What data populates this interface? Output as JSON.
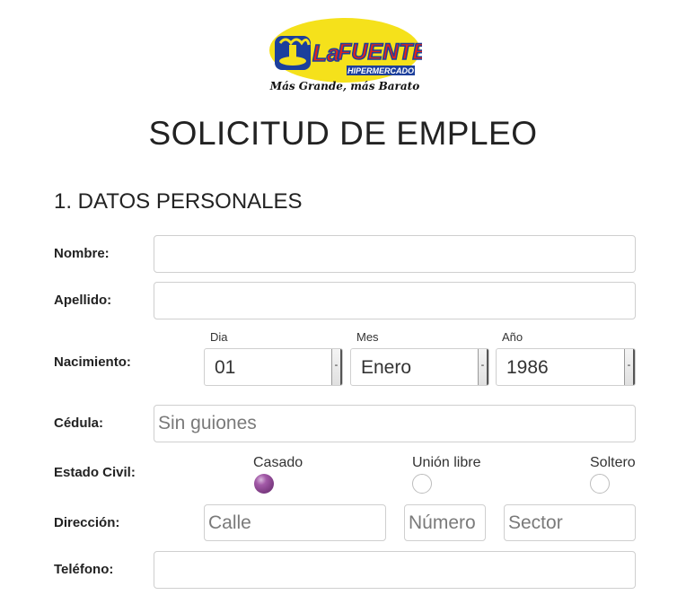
{
  "logo": {
    "brand_prefix": "La",
    "brand_name": "FUENTE",
    "subtitle": "HIPERMERCADO",
    "slogan": "Más Grande, más Barato",
    "colors": {
      "yellow": "#f5e11b",
      "red": "#e2231a",
      "blue": "#1c3f9c"
    }
  },
  "page": {
    "title": "SOLICITUD DE EMPLEO"
  },
  "section": {
    "title": "1. DATOS PERSONALES"
  },
  "form": {
    "nombre_label": "Nombre:",
    "nombre_value": "",
    "apellido_label": "Apellido:",
    "apellido_value": "",
    "nacimiento_label": "Nacimiento:",
    "dia_label": "Dia",
    "dia_value": "01",
    "mes_label": "Mes",
    "mes_value": "Enero",
    "anio_label": "Año",
    "anio_value": "1986",
    "spinner_glyph": "-",
    "cedula_label": "Cédula:",
    "cedula_placeholder": "Sin guiones",
    "estado_civil_label": "Estado Civil:",
    "estado_options": [
      {
        "label": "Casado",
        "checked": true
      },
      {
        "label": "Unión libre",
        "checked": false
      },
      {
        "label": "Soltero",
        "checked": false
      }
    ],
    "direccion_label": "Dirección:",
    "calle_placeholder": "Calle",
    "numero_placeholder": "Número",
    "sector_placeholder": "Sector",
    "telefono_label": "Teléfono:",
    "telefono_value": ""
  },
  "accent_color": "#7c3b82"
}
